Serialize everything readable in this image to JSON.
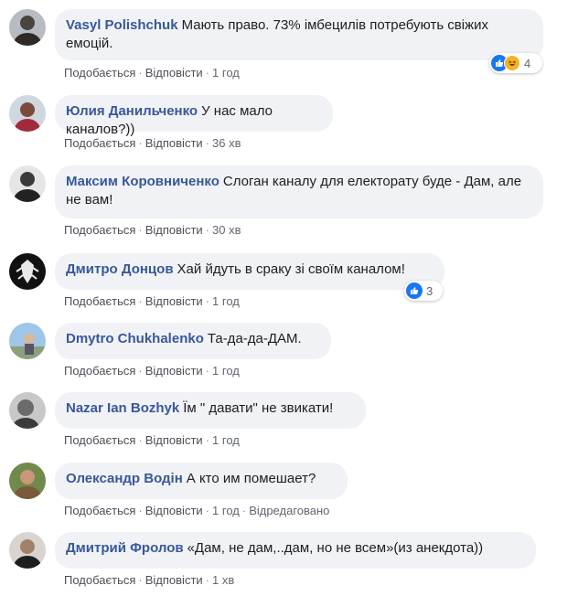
{
  "actions": {
    "like": "Подобається",
    "reply": "Відповісти"
  },
  "comments": [
    {
      "author": "Vasyl Polishchuk",
      "text": "Мають право. 73% імбецилів потребують свіжих емоцій.",
      "time": "1 год",
      "edited": "",
      "reactions": {
        "icons": [
          "like-icon",
          "haha-icon"
        ],
        "count": "4"
      }
    },
    {
      "author": "Юлия Данильченко",
      "text": "У нас мало каналов?))",
      "time": "36 хв",
      "edited": "",
      "reactions": null
    },
    {
      "author": "Максим Коровниченко",
      "text": "Слоган каналу для електорату буде - Дам, але не вам!",
      "time": "30 хв",
      "edited": "",
      "reactions": null
    },
    {
      "author": "Дмитро Донцов",
      "text": "Хай йдуть в сраку зі своїм каналом!",
      "time": "1 год",
      "edited": "",
      "reactions": {
        "icons": [
          "like-icon"
        ],
        "count": "3"
      }
    },
    {
      "author": "Dmytro Chukhalenko",
      "text": "Та-да-да-ДАМ.",
      "time": "1 год",
      "edited": "",
      "reactions": null
    },
    {
      "author": "Nazar Ian Bozhyk",
      "text": "Їм \" давати\" не звикати!",
      "time": "1 год",
      "edited": "",
      "reactions": null
    },
    {
      "author": "Олександр Водін",
      "text": "А кто им помешает?",
      "time": "1 год",
      "edited": "Відредаговано",
      "reactions": null
    },
    {
      "author": "Дмитрий Фролов",
      "text": "«Дам, не дам,..дам, но не всем»(из анекдота))",
      "time": "1 хв",
      "edited": "",
      "reactions": null
    }
  ],
  "colors": {
    "bubble": "#f0f2f5",
    "author": "#385898",
    "meta": "#606770",
    "like": "#1877f2",
    "haha": "#f7b125"
  }
}
